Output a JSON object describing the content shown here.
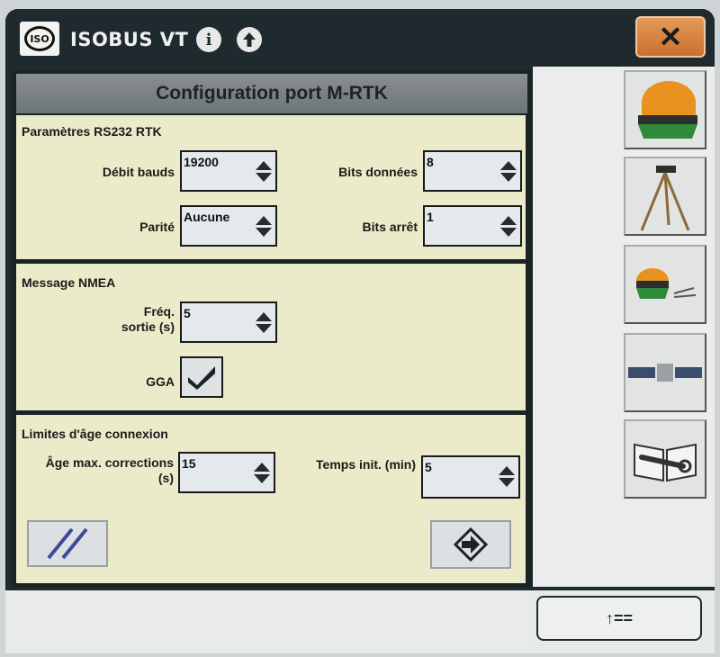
{
  "app": {
    "title": "ISOBUS VT",
    "logo_text": "ISO",
    "close_label": "✕"
  },
  "screen": {
    "title": "Configuration port M-RTK"
  },
  "rs232": {
    "section_title": "Paramètres RS232 RTK",
    "baud": {
      "label": "Débit bauds",
      "value": "19200"
    },
    "data_bits": {
      "label": "Bits données",
      "value": "8"
    },
    "parity": {
      "label": "Parité",
      "value": "Aucune"
    },
    "stop_bits": {
      "label": "Bits arrêt",
      "value": "1"
    }
  },
  "nmea": {
    "section_title": "Message NMEA",
    "freq": {
      "label_line1": "Fréq.",
      "label_line2": "sortie (s)",
      "value": "5"
    },
    "gga": {
      "label": "GGA",
      "checked": true
    }
  },
  "age_limits": {
    "section_title": "Limites d'âge connexion",
    "max_corrections": {
      "label_line1": "Âge max. corrections",
      "label_line2": "(s)",
      "value": "15"
    },
    "init_time": {
      "label": "Temps init. (min)",
      "value": "5"
    }
  },
  "side_buttons": [
    "receiver-icon",
    "tripod-icon",
    "receiver-config-icon",
    "satellite-icon",
    "manual-tools-icon"
  ],
  "footer": {
    "page_button_label": "↑=="
  },
  "colors": {
    "accent_orange": "#e08a3a",
    "panel_bg": "#ecebc9",
    "frame": "#1e2a2d"
  }
}
